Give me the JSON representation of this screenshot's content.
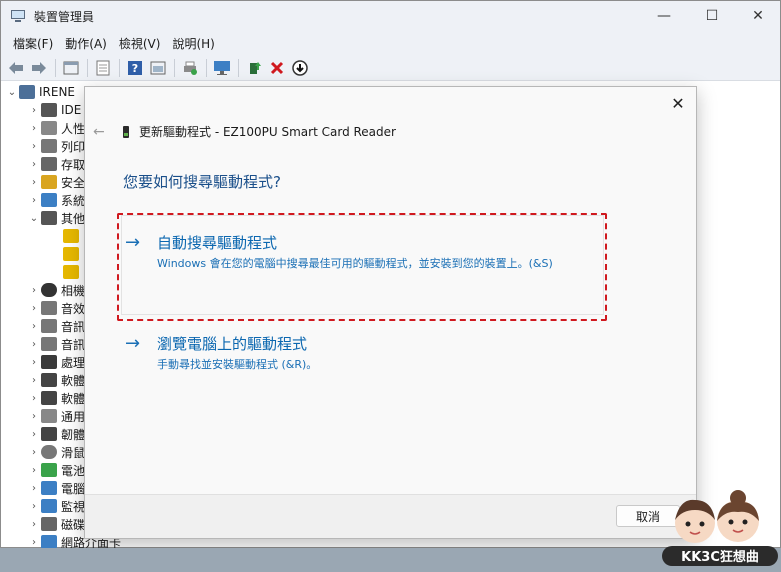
{
  "window": {
    "title": "裝置管理員",
    "controls": {
      "minimize": "—",
      "maximize": "☐",
      "close": "✕"
    }
  },
  "menu": {
    "items": [
      "檔案(F)",
      "動作(A)",
      "檢視(V)",
      "說明(H)"
    ]
  },
  "toolbar": {
    "icons": [
      "back-icon",
      "forward-icon",
      "properties-icon",
      "sheet-icon",
      "help-icon",
      "view-icon",
      "print-icon",
      "monitor-icon",
      "update-driver-icon",
      "uninstall-icon",
      "scan-hardware-icon"
    ]
  },
  "tree": {
    "root": "IRENE",
    "nodes": [
      "IDE",
      "人性",
      "列印",
      "存取",
      "安全",
      "系統",
      "其他",
      "",
      "",
      "",
      "相機",
      "音效",
      "音訊",
      "音訊",
      "處理",
      "軟體",
      "軟體",
      "通用",
      "韌體",
      "滑鼠",
      "電池",
      "電腦",
      "監視",
      "磁碟",
      "網路介面卡"
    ]
  },
  "dialog": {
    "title": "更新驅動程式 - EZ100PU Smart Card Reader",
    "question": "您要如何搜尋驅動程式?",
    "option_auto": {
      "title": "自動搜尋驅動程式",
      "description": "Windows 會在您的電腦中搜尋最佳可用的驅動程式，並安裝到您的裝置上。(&S)"
    },
    "option_browse": {
      "title": "瀏覽電腦上的驅動程式",
      "description": "手動尋找並安裝驅動程式 (&R)。"
    },
    "cancel_label": "取消",
    "close_glyph": "✕",
    "back_glyph": "←",
    "arrow_glyph": "→"
  },
  "watermark": {
    "text": "KK3C狂想曲"
  },
  "colors": {
    "accent": "#0b67b0",
    "highlight": "#d0191f",
    "question": "#1a4f8a"
  }
}
